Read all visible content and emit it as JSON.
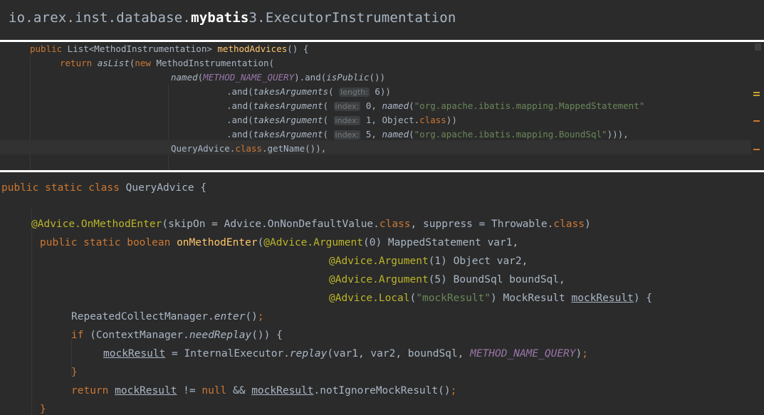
{
  "header": {
    "prefix": "io.arex.inst.database.",
    "bold": "mybatis",
    "suffix": "3.ExecutorInstrumentation"
  },
  "snippet1": {
    "l1": {
      "a": "public",
      "b": " List<MethodInstrumentation> ",
      "c": "methodAdvices",
      "d": "() {"
    },
    "l2": {
      "a": "return",
      "b": "asList",
      "c": "(",
      "d": "new",
      "e": " MethodInstrumentation("
    },
    "l3": {
      "a": "named",
      "b": "(",
      "c": "METHOD_NAME_QUERY",
      "d": ").and(",
      "e": "isPublic",
      "f": "())"
    },
    "l4": {
      "a": ".and(",
      "b": "takesArguments",
      "c": "( ",
      "hint": "length:",
      "d": " 6))"
    },
    "l5": {
      "a": ".and(",
      "b": "takesArgument",
      "c": "( ",
      "hint": "index:",
      "d": " 0, ",
      "e": "named",
      "f": "(",
      "g": "\"org.apache.ibatis.mapping.MappedStatement\""
    },
    "l6": {
      "a": ".and(",
      "b": "takesArgument",
      "c": "( ",
      "hint": "index:",
      "d": " 1, Object.",
      "e": "class",
      "f": "))"
    },
    "l7": {
      "a": ".and(",
      "b": "takesArgument",
      "c": "( ",
      "hint": "index:",
      "d": " 5, ",
      "e": "named",
      "f": "(",
      "g": "\"org.apache.ibatis.mapping.BoundSql\"",
      "h": "))),"
    },
    "l8": {
      "a": "QueryAdvice.",
      "b": "class",
      "c": ".getName()),"
    }
  },
  "snippet2": {
    "l1": {
      "a": "public static class",
      "b": " QueryAdvice {"
    },
    "l2": {
      "a": "@Advice.",
      "b": "OnMethodEnter",
      "c": "(skipOn = Advice.OnNonDefaultValue.",
      "d": "class",
      "e": ", suppress = Throwable.",
      "f": "class",
      "g": ")"
    },
    "l3": {
      "a": "public static boolean",
      "b": "onMethodEnter",
      "c": "(",
      "d": "@Advice.",
      "e": "Argument",
      "f": "(0) MappedStatement var1,"
    },
    "l4": {
      "a": "@Advice.",
      "b": "Argument",
      "c": "(1) Object var2,"
    },
    "l5": {
      "a": "@Advice.",
      "b": "Argument",
      "c": "(5) BoundSql boundSql,"
    },
    "l6": {
      "a": "@Advice.",
      "b": "Local",
      "c": "(",
      "d": "\"mockResult\"",
      "e": ") MockResult ",
      "f": "mockResult",
      "g": ") {"
    },
    "l7": {
      "a": "RepeatedCollectManager.",
      "b": "enter",
      "c": "()",
      "d": ";"
    },
    "l8": {
      "a": "if",
      "b": " (ContextManager.",
      "c": "needReplay",
      "d": "()) {"
    },
    "l9": {
      "a": "mockResult",
      "b": " = InternalExecutor.",
      "c": "replay",
      "d": "(var1, var2, boundSql, ",
      "e": "METHOD_NAME_QUERY",
      "f": ")",
      "g": ";"
    },
    "l10": {
      "a": "}"
    },
    "l11": {
      "a": "return",
      "b": "mockResult",
      "c": " != ",
      "d": "null",
      "e": " && ",
      "f": "mockResult",
      "g": ".notIgnoreMockResult()",
      "h": ";"
    },
    "l12": {
      "a": "}"
    }
  }
}
